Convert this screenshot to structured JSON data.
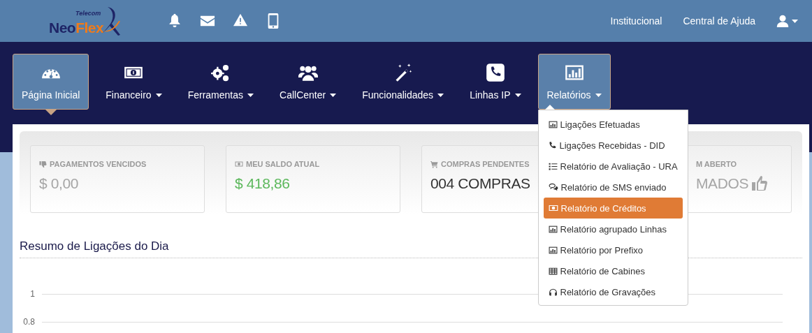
{
  "header": {
    "logo": {
      "tagline": "Telecom",
      "words": [
        "Neo",
        "Flex"
      ]
    },
    "links": [
      "Institucional",
      "Central de Ajuda"
    ]
  },
  "nav": [
    {
      "label": "Página Inicial",
      "dropdown": false,
      "selected": true,
      "expanded": false
    },
    {
      "label": "Financeiro",
      "dropdown": true,
      "selected": false,
      "expanded": false
    },
    {
      "label": "Ferramentas",
      "dropdown": true,
      "selected": false,
      "expanded": false
    },
    {
      "label": "CallCenter",
      "dropdown": true,
      "selected": false,
      "expanded": false
    },
    {
      "label": "Funcionalidades",
      "dropdown": true,
      "selected": false,
      "expanded": false
    },
    {
      "label": "Linhas IP",
      "dropdown": true,
      "selected": false,
      "expanded": false
    },
    {
      "label": "Relatórios",
      "dropdown": true,
      "selected": false,
      "expanded": true,
      "menu": [
        {
          "label": "Ligações Efetuadas",
          "selected": false
        },
        {
          "label": "Ligações Recebidas - DID",
          "selected": false
        },
        {
          "label": "Relatório de Avaliação - URA",
          "selected": false
        },
        {
          "label": "Relatório de SMS enviado",
          "selected": false
        },
        {
          "label": "Relatório de Créditos",
          "selected": true
        },
        {
          "label": "Relatório agrupado Linhas",
          "selected": false
        },
        {
          "label": "Relatório por Prefixo",
          "selected": false
        },
        {
          "label": "Relatório de Cabines",
          "selected": false
        },
        {
          "label": "Relatório de Gravações",
          "selected": false
        }
      ]
    }
  ],
  "stats": [
    {
      "label": "PAGAMENTOS VENCIDOS",
      "value": "$ 0,00",
      "color": "#a6a6a6"
    },
    {
      "label": "MEU SALDO ATUAL",
      "value": "$ 418,86",
      "color": "#5cb85c"
    },
    {
      "label": "COMPRAS PENDENTES",
      "value": "004 COMPRAS",
      "color": "#333333"
    },
    {
      "label": "M ABERTO",
      "value": "MADOS",
      "color": "#a6a6a6"
    }
  ],
  "summary": {
    "title": "Resumo de Ligações do Dia",
    "y_tick_labels": [
      "1",
      "0.8"
    ]
  }
}
